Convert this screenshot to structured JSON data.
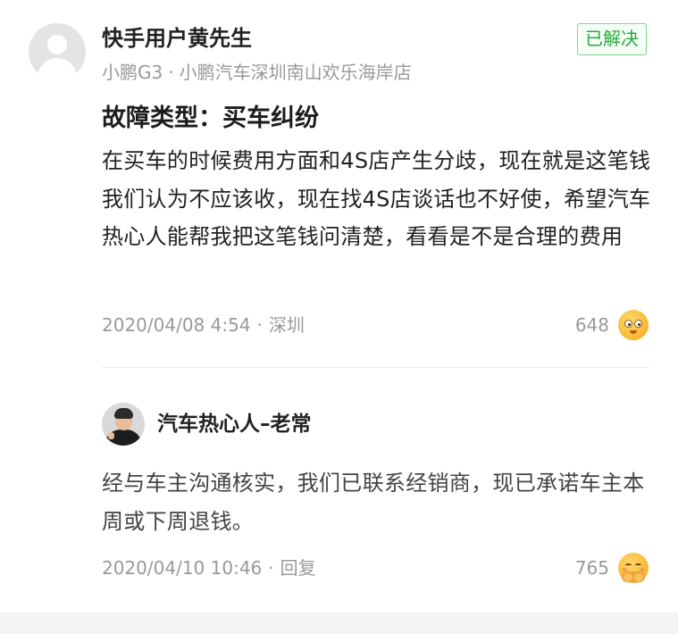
{
  "post": {
    "username": "快手用户黄先生",
    "car_model": "小鹏G3",
    "meta_separator": "·",
    "dealer": "小鹏汽车深圳南山欢乐海岸店",
    "status_badge": "已解决",
    "fault_title": "故障类型：买车纠纷",
    "body": "在买车的时候费用方面和4S店产生分歧，现在就是这笔钱我们认为不应该收，现在找4S店谈话也不好使，希望汽车热心人能帮我把这笔钱问清楚，看看是不是合理的费用",
    "date": "2020/04/08 4:54",
    "location_separator": "·",
    "location": "深圳",
    "reaction_count": "648",
    "reaction_icon": "peeking-eyes-emoji-icon"
  },
  "reply": {
    "author": "汽车热心人–老常",
    "body": "经与车主沟通核实，我们已联系经销商，现已承诺车主本周或下周退钱。",
    "date": "2020/04/10 10:46",
    "action_separator": "·",
    "action_label": "回复",
    "reaction_count": "765",
    "reaction_icon": "shy-smile-emoji-icon"
  },
  "colors": {
    "badge_green": "#29a83c",
    "meta_gray": "#999999",
    "emoji_yellow": "#f7b733"
  }
}
